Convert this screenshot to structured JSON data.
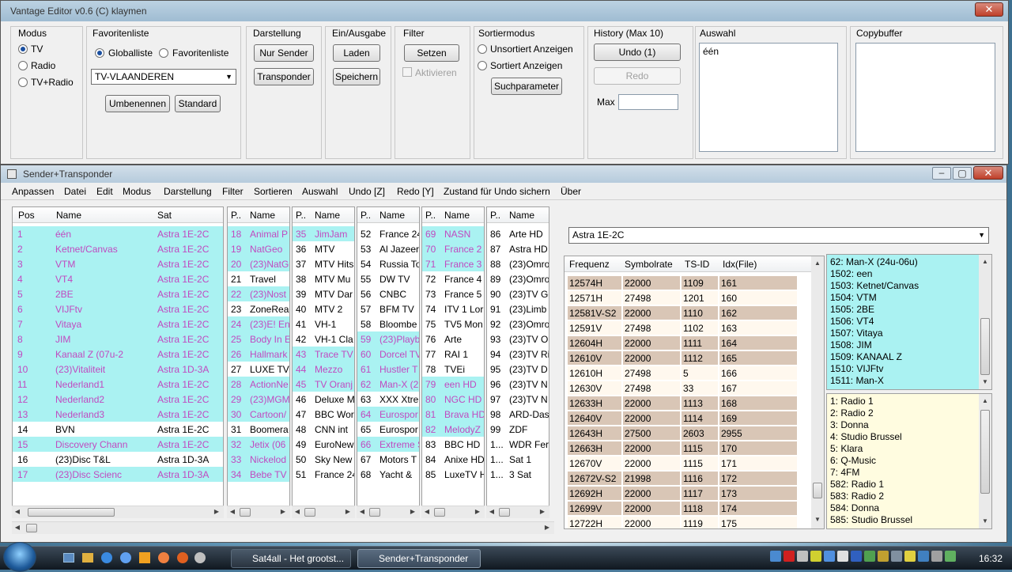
{
  "editor": {
    "title": "Vantage Editor v0.6 (C) klaymen",
    "modus": {
      "label": "Modus",
      "options": [
        "TV",
        "Radio",
        "TV+Radio"
      ],
      "selected": "TV"
    },
    "favoritenliste": {
      "label": "Favoritenliste",
      "opt1": "Globalliste",
      "opt2": "Favoritenliste",
      "combo": "TV-VLAANDEREN",
      "rename": "Umbenennen",
      "standard": "Standard"
    },
    "darstellung": {
      "label": "Darstellung",
      "b1": "Nur Sender",
      "b2": "Transponder"
    },
    "einausgabe": {
      "label": "Ein/Ausgabe",
      "b1": "Laden",
      "b2": "Speichern"
    },
    "filter": {
      "label": "Filter",
      "b1": "Setzen",
      "active": "Aktivieren"
    },
    "sort": {
      "label": "Sortiermodus",
      "opt1": "Unsortiert Anzeigen",
      "opt2": "Sortiert Anzeigen",
      "btn": "Suchparameter"
    },
    "history": {
      "label": "History (Max 10)",
      "undo": "Undo (1)",
      "redo": "Redo",
      "max": "Max"
    },
    "auswahl": {
      "label": "Auswahl",
      "value": "één"
    },
    "copybuffer": {
      "label": "Copybuffer"
    }
  },
  "sender": {
    "title": "Sender+Transponder",
    "menu": [
      "Anpassen",
      "Datei",
      "Edit",
      "Modus",
      "Darstellung",
      "Filter",
      "Sortieren",
      "Auswahl",
      "Undo [Z]",
      "Redo [Y]",
      "Zustand für Undo sichern",
      "Über"
    ],
    "main_headers": [
      "Pos",
      "Name",
      "Sat"
    ],
    "main_rows": [
      [
        "1",
        "één",
        "Astra 1E-2C"
      ],
      [
        "2",
        "Ketnet/Canvas",
        "Astra 1E-2C"
      ],
      [
        "3",
        "VTM",
        "Astra 1E-2C"
      ],
      [
        "4",
        "VT4",
        "Astra 1E-2C"
      ],
      [
        "5",
        "2BE",
        "Astra 1E-2C"
      ],
      [
        "6",
        "VIJFtv",
        "Astra 1E-2C"
      ],
      [
        "7",
        "Vitaya",
        "Astra 1E-2C"
      ],
      [
        "8",
        "JIM",
        "Astra 1E-2C"
      ],
      [
        "9",
        "Kanaal Z (07u-2",
        "Astra 1E-2C"
      ],
      [
        "10",
        "(23)Vitaliteit",
        "Astra 1D-3A"
      ],
      [
        "11",
        "Nederland1",
        "Astra 1E-2C"
      ],
      [
        "12",
        "Nederland2",
        "Astra 1E-2C"
      ],
      [
        "13",
        "Nederland3",
        "Astra 1E-2C"
      ],
      [
        "14",
        "BVN",
        "Astra 1E-2C"
      ],
      [
        "15",
        "Discovery Chann",
        "Astra 1E-2C"
      ],
      [
        "16",
        "(23)Disc T&L",
        "Astra 1D-3A"
      ],
      [
        "17",
        "(23)Disc Scienc",
        "Astra 1D-3A"
      ]
    ],
    "main_styles": [
      "cm",
      "cm",
      "cm",
      "cm",
      "cm",
      "cm",
      "cm",
      "cm",
      "cm",
      "cm",
      "cm",
      "cm",
      "cm",
      "n",
      "cm",
      "n",
      "cm"
    ],
    "sub_header": [
      "P..",
      "Name"
    ],
    "sub_lists": [
      {
        "rows": [
          [
            "18",
            "Animal P"
          ],
          [
            "19",
            "NatGeo"
          ],
          [
            "20",
            "(23)NatG"
          ],
          [
            "21",
            "Travel"
          ],
          [
            "22",
            "(23)Nost"
          ],
          [
            "23",
            "ZoneRea"
          ],
          [
            "24",
            "(23)E! Ent"
          ],
          [
            "25",
            "Body In E"
          ],
          [
            "26",
            "Hallmark"
          ],
          [
            "27",
            "LUXE TV"
          ],
          [
            "28",
            "ActionNe"
          ],
          [
            "29",
            "(23)MGM"
          ],
          [
            "30",
            "Cartoon/"
          ],
          [
            "31",
            "Boomera"
          ],
          [
            "32",
            "Jetix (06"
          ],
          [
            "33",
            "Nickelod"
          ],
          [
            "34",
            "Bebe TV"
          ]
        ],
        "styles": [
          "cm",
          "cm",
          "cm",
          "n",
          "cm",
          "n",
          "cm",
          "cm",
          "cm",
          "n",
          "cm",
          "cm",
          "cm",
          "n",
          "cm",
          "cm",
          "cm"
        ]
      },
      {
        "rows": [
          [
            "35",
            "JimJam"
          ],
          [
            "36",
            "MTV"
          ],
          [
            "37",
            "MTV Hits"
          ],
          [
            "38",
            "MTV Mu"
          ],
          [
            "39",
            "MTV Dar"
          ],
          [
            "40",
            "MTV 2"
          ],
          [
            "41",
            "VH-1"
          ],
          [
            "42",
            "VH-1 Cla"
          ],
          [
            "43",
            "Trace TV"
          ],
          [
            "44",
            "Mezzo"
          ],
          [
            "45",
            "TV Oranj"
          ],
          [
            "46",
            "Deluxe M"
          ],
          [
            "47",
            "BBC Wor"
          ],
          [
            "48",
            "CNN int"
          ],
          [
            "49",
            "EuroNew"
          ],
          [
            "50",
            "Sky New"
          ],
          [
            "51",
            "France 24"
          ]
        ],
        "styles": [
          "cm",
          "n",
          "n",
          "n",
          "n",
          "n",
          "n",
          "n",
          "cm",
          "cm",
          "cm",
          "n",
          "n",
          "n",
          "n",
          "n",
          "n"
        ]
      },
      {
        "rows": [
          [
            "52",
            "France 24"
          ],
          [
            "53",
            "Al Jazeera"
          ],
          [
            "54",
            "Russia To"
          ],
          [
            "55",
            "DW TV"
          ],
          [
            "56",
            "CNBC"
          ],
          [
            "57",
            "BFM TV"
          ],
          [
            "58",
            "Bloombe"
          ],
          [
            "59",
            "(23)Playb"
          ],
          [
            "60",
            "Dorcel TV"
          ],
          [
            "61",
            "Hustler T"
          ],
          [
            "62",
            "Man-X (2"
          ],
          [
            "63",
            "XXX Xtre"
          ],
          [
            "64",
            "Eurospor"
          ],
          [
            "65",
            "Eurospor"
          ],
          [
            "66",
            "Extreme S"
          ],
          [
            "67",
            "Motors T"
          ],
          [
            "68",
            "Yacht & "
          ]
        ],
        "styles": [
          "n",
          "n",
          "n",
          "n",
          "n",
          "n",
          "n",
          "cm",
          "cm",
          "cm",
          "cm",
          "n",
          "cm",
          "n",
          "cm",
          "n",
          "n"
        ]
      },
      {
        "rows": [
          [
            "69",
            "NASN"
          ],
          [
            "70",
            "France 2"
          ],
          [
            "71",
            "France 3"
          ],
          [
            "72",
            "France 4"
          ],
          [
            "73",
            "France 5"
          ],
          [
            "74",
            "ITV 1 Lor"
          ],
          [
            "75",
            "TV5 Mon"
          ],
          [
            "76",
            "Arte"
          ],
          [
            "77",
            "RAI 1"
          ],
          [
            "78",
            "TVEi"
          ],
          [
            "79",
            "een HD"
          ],
          [
            "80",
            "NGC HD"
          ],
          [
            "81",
            "Brava HD"
          ],
          [
            "82",
            "MelodyZ"
          ],
          [
            "83",
            "BBC HD"
          ],
          [
            "84",
            "Anixe HD"
          ],
          [
            "85",
            "LuxeTV H"
          ]
        ],
        "styles": [
          "cm",
          "cm",
          "cm",
          "n",
          "n",
          "n",
          "n",
          "n",
          "n",
          "n",
          "cm",
          "cm",
          "cm",
          "cm",
          "n",
          "n",
          "n"
        ]
      },
      {
        "rows": [
          [
            "86",
            "Arte HD"
          ],
          [
            "87",
            "Astra HD"
          ],
          [
            "88",
            "(23)Omro"
          ],
          [
            "89",
            "(23)Omro"
          ],
          [
            "90",
            "(23)TV Ge"
          ],
          [
            "91",
            "(23)Limb"
          ],
          [
            "92",
            "(23)Omro"
          ],
          [
            "93",
            "(23)TV O"
          ],
          [
            "94",
            "(23)TV Ri"
          ],
          [
            "95",
            "(23)TV D"
          ],
          [
            "96",
            "(23)TV N"
          ],
          [
            "97",
            "(23)TV N"
          ],
          [
            "98",
            "ARD-Das"
          ],
          [
            "99",
            "ZDF"
          ],
          [
            "1...",
            "WDR Fer"
          ],
          [
            "1...",
            "Sat 1"
          ],
          [
            "1...",
            "3 Sat"
          ]
        ],
        "styles": [
          "n",
          "n",
          "n",
          "n",
          "n",
          "n",
          "n",
          "n",
          "n",
          "n",
          "n",
          "n",
          "n",
          "n",
          "n",
          "n",
          "n"
        ]
      }
    ],
    "sat_combo": "Astra 1E-2C",
    "tp_headers": [
      "Frequenz",
      "Symbolrate",
      "TS-ID",
      "Idx(File)"
    ],
    "tp_rows": [
      [
        "12574H",
        "22000",
        "1109",
        "161"
      ],
      [
        "12571H",
        "27498",
        "1201",
        "160"
      ],
      [
        "12581V-S2",
        "22000",
        "1110",
        "162"
      ],
      [
        "12591V",
        "27498",
        "1102",
        "163"
      ],
      [
        "12604H",
        "22000",
        "1111",
        "164"
      ],
      [
        "12610V",
        "22000",
        "1112",
        "165"
      ],
      [
        "12610H",
        "27498",
        "5",
        "166"
      ],
      [
        "12630V",
        "27498",
        "33",
        "167"
      ],
      [
        "12633H",
        "22000",
        "1113",
        "168"
      ],
      [
        "12640V",
        "22000",
        "1114",
        "169"
      ],
      [
        "12643H",
        "27500",
        "2603",
        "2955"
      ],
      [
        "12663H",
        "22000",
        "1115",
        "170"
      ],
      [
        "12670V",
        "22000",
        "1115",
        "171"
      ],
      [
        "12672V-S2",
        "21998",
        "1116",
        "172"
      ],
      [
        "12692H",
        "22000",
        "1117",
        "173"
      ],
      [
        "12699V",
        "22000",
        "1118",
        "174"
      ],
      [
        "12722H",
        "22000",
        "1119",
        "175"
      ]
    ],
    "tp_styles": [
      "b",
      "l",
      "b",
      "l",
      "b",
      "b",
      "l",
      "l",
      "b",
      "b",
      "b",
      "b",
      "l",
      "b",
      "b",
      "b",
      "l"
    ],
    "list_cyan": [
      "62: Man-X (24u-06u)",
      "1502: een",
      "1503: Ketnet/Canvas",
      "1504: VTM",
      "1505: 2BE",
      "1506: VT4",
      "1507: Vitaya",
      "1508: JIM",
      "1509: KANAAL Z",
      "1510: VIJFtv",
      "1511: Man-X"
    ],
    "list_yellow": [
      "1: Radio 1",
      "2: Radio 2",
      "3: Donna",
      "4: Studio Brussel",
      "5: Klara",
      "6: Q-Music",
      "7: 4FM",
      "582: Radio 1",
      "583: Radio 2",
      "584: Donna",
      "585: Studio Brussel"
    ]
  },
  "taskbar": {
    "btn1": "Sat4all - Het grootst...",
    "btn2": "Sender+Transponder",
    "clock": "16:32"
  }
}
